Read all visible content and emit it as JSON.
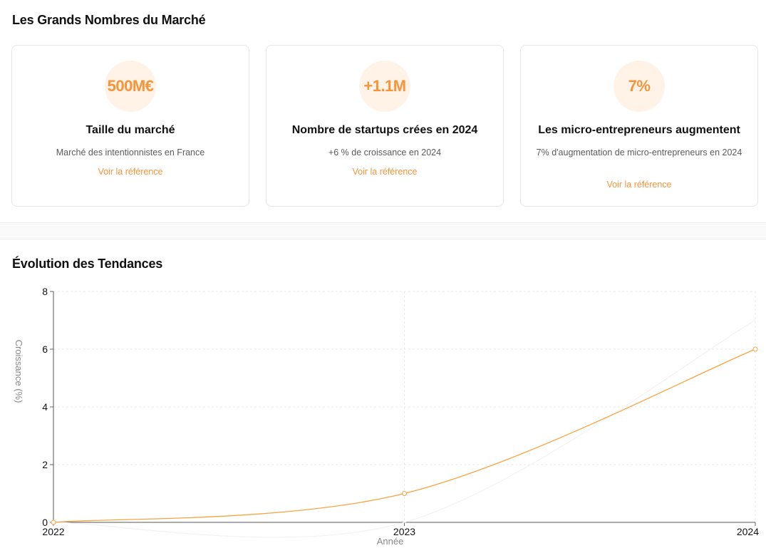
{
  "market": {
    "title": "Les Grands Nombres du Marché",
    "cards": [
      {
        "value": "500M€",
        "title": "Taille du marché",
        "description": "Marché des intentionnistes en France",
        "link": "Voir la référence"
      },
      {
        "value": "+1.1M",
        "title": "Nombre de startups crées en 2024",
        "description": "+6 % de croissance en 2024",
        "link": "Voir la référence"
      },
      {
        "value": "7%",
        "title": "Les micro-entrepreneurs augmentent",
        "description": "7% d'augmentation de micro-entrepreneurs en 2024",
        "link": "Voir la référence"
      }
    ]
  },
  "trends": {
    "title": "Évolution des Tendances"
  },
  "chart_data": {
    "type": "line",
    "x": [
      "2022",
      "2023",
      "2024"
    ],
    "xlabel": "Année",
    "ylabel": "Croissance (%)",
    "ylim": [
      0,
      8
    ],
    "yticks": [
      "0",
      "2",
      "4",
      "6",
      "8"
    ],
    "grid": true,
    "series": [
      {
        "values": [
          0,
          1,
          6
        ],
        "color": "#f7a440",
        "markers": true
      },
      {
        "values": [
          0,
          0,
          7
        ],
        "color": "#f2f2f2",
        "markers": false
      }
    ]
  }
}
